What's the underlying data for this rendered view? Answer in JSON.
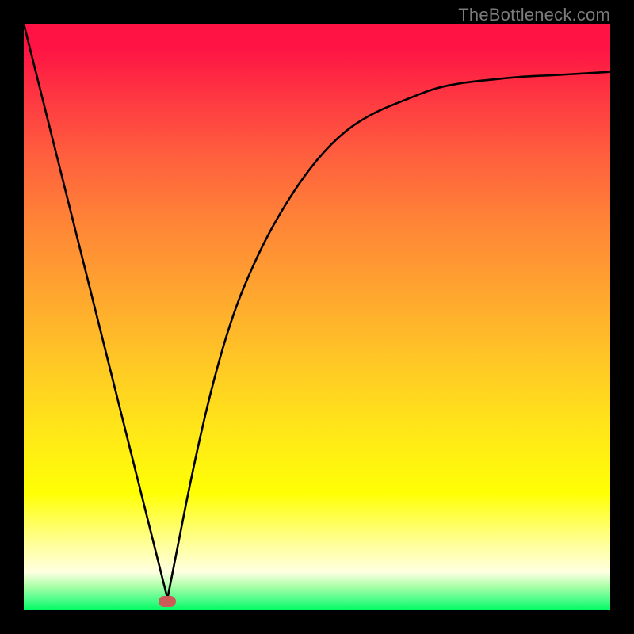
{
  "watermark": {
    "text": "TheBottleneck.com"
  },
  "plot": {
    "background_top_color": "#fe1344",
    "background_bottom_color": "#00fa63",
    "curve_color": "#000000",
    "marker_color": "#cc5a57",
    "marker_x_frac": 0.245,
    "marker_y_frac": 0.985
  },
  "chart_data": {
    "type": "line",
    "title": "",
    "xlabel": "",
    "ylabel": "",
    "xlim": [
      0,
      1
    ],
    "ylim": [
      0,
      1
    ],
    "series": [
      {
        "name": "bottleneck-curve",
        "x": [
          0.0,
          0.05,
          0.1,
          0.15,
          0.2,
          0.245,
          0.3,
          0.35,
          0.4,
          0.45,
          0.5,
          0.55,
          0.6,
          0.65,
          0.7,
          0.75,
          0.8,
          0.85,
          0.9,
          0.95,
          1.0
        ],
        "y": [
          1.0,
          0.8,
          0.6,
          0.4,
          0.2,
          0.02,
          0.3,
          0.49,
          0.61,
          0.7,
          0.77,
          0.82,
          0.85,
          0.87,
          0.89,
          0.9,
          0.905,
          0.91,
          0.912,
          0.915,
          0.918
        ]
      }
    ],
    "annotations": [
      {
        "name": "curve-minimum-marker",
        "x": 0.245,
        "y": 0.02
      }
    ]
  }
}
